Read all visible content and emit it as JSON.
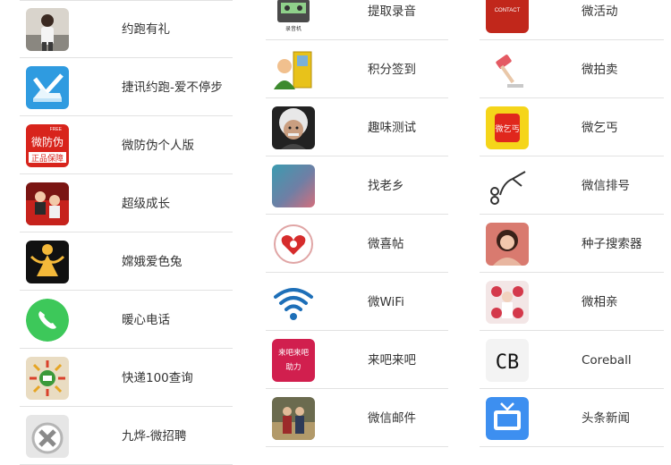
{
  "columns": [
    {
      "items": [
        {
          "label": "约跑有礼",
          "icon": "runner-photo-icon"
        },
        {
          "label": "捷讯约跑-爱不停步",
          "icon": "shoe-check-icon"
        },
        {
          "label": "微防伪个人版",
          "icon": "anti-counterfeit-icon",
          "icon_text": "微防伪",
          "icon_sub": "正品保障",
          "icon_badge": "FREE"
        },
        {
          "label": "超级成长",
          "icon": "growth-photo-icon"
        },
        {
          "label": "嫦娥爱色兔",
          "icon": "moon-lady-icon"
        },
        {
          "label": "暖心电话",
          "icon": "phone-icon"
        },
        {
          "label": "快递100查询",
          "icon": "express-100-icon"
        },
        {
          "label": "九烨-微招聘",
          "icon": "close-x-icon"
        }
      ]
    },
    {
      "items": [
        {
          "label": "提取录音",
          "icon": "cassette-recorder-icon",
          "icon_text": "录音机"
        },
        {
          "label": "积分签到",
          "icon": "user-door-checkin-icon"
        },
        {
          "label": "趣味测试",
          "icon": "einstein-photo-icon"
        },
        {
          "label": "找老乡",
          "icon": "blur-gradient-icon"
        },
        {
          "label": "微喜帖",
          "icon": "heart-invitation-icon"
        },
        {
          "label": "微WiFi",
          "icon": "wifi-icon"
        },
        {
          "label": "来吧来吧",
          "icon": "come-on-icon",
          "icon_text_1": "来吧来吧",
          "icon_text_2": "助力"
        },
        {
          "label": "微信邮件",
          "icon": "couple-photo-icon"
        }
      ]
    },
    {
      "items": [
        {
          "label": "微活动",
          "icon": "contact-card-icon",
          "icon_text": "CONTACT"
        },
        {
          "label": "微拍卖",
          "icon": "auction-gavel-icon"
        },
        {
          "label": "微乞丐",
          "icon": "beggar-icon",
          "icon_text": "微乞丐"
        },
        {
          "label": "微信排号",
          "icon": "hand-number-icon"
        },
        {
          "label": "种子搜索器",
          "icon": "girl-photo-icon"
        },
        {
          "label": "微相亲",
          "icon": "blind-date-icon"
        },
        {
          "label": "Coreball",
          "icon": "cb-logo-icon",
          "icon_text": "CB"
        },
        {
          "label": "头条新闻",
          "icon": "tv-icon"
        }
      ]
    }
  ]
}
